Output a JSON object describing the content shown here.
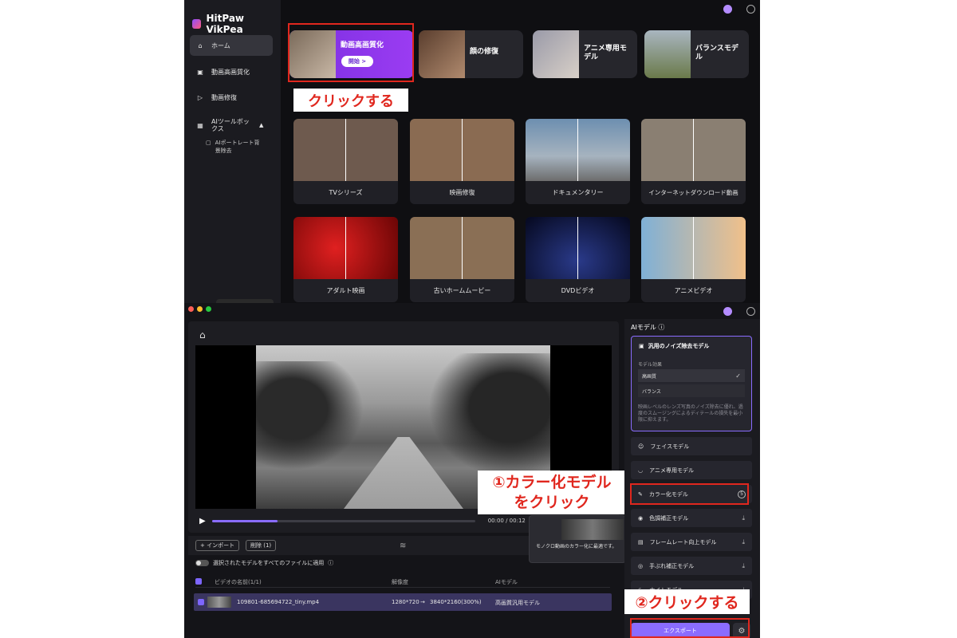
{
  "top_window": {
    "app_name": "HitPaw VikPea",
    "nav": [
      {
        "label": "ホーム"
      },
      {
        "label": "動画高画質化"
      },
      {
        "label": "動画修復"
      },
      {
        "label": "AIツールボックス"
      }
    ],
    "sub_item": "AIポートレート背景除去",
    "main_cards": [
      {
        "label": "動画高画質化",
        "button": "開始 >"
      },
      {
        "label": "顔の修復"
      },
      {
        "label": "アニメ専用モデル"
      },
      {
        "label": "バランスモデル"
      }
    ],
    "callout": "クリックする",
    "grid": [
      {
        "label": "TVシリーズ",
        "color": "#6e5a4e"
      },
      {
        "label": "映画修復",
        "color": "#8a6b52"
      },
      {
        "label": "ドキュメンタリー",
        "color": "#6d8fb0"
      },
      {
        "label": "インターネットダウンロード動画",
        "color": "#8a7f72"
      },
      {
        "label": "アダルト映画",
        "color": "#a50f0f"
      },
      {
        "label": "古いホームムービー",
        "color": "#8a6f55"
      },
      {
        "label": "DVDビデオ",
        "color": "#0e1b4e"
      },
      {
        "label": "アニメビデオ",
        "color": "#e8b07a"
      }
    ]
  },
  "bottom_window": {
    "time": "00:00 / 00:12",
    "tooltip": "モノクロ動画のカラー化に最適です。",
    "buttons": {
      "import": "+ インポート",
      "delete": "削除 (1)"
    },
    "apply_label": "選択されたモデルをすべてのファイルに適用",
    "table_headers": [
      "ビデオの名前(1/1)",
      "解像度",
      "AIモデル"
    ],
    "row": {
      "name": "109801-685694722_tiny.mp4",
      "res_from": "1280*720",
      "res_to": "3840*2160(300%)",
      "model": "高画質汎用モデル"
    },
    "panel_title": "AIモデル",
    "selected_model": {
      "title": "汎用のノイズ除去モデル",
      "effect_label": "モデル効果",
      "options": [
        "高画質",
        "バランス"
      ],
      "description": "映画レベルのレンズ写真のノイズ除去に優れ、過度のスムージングによるディテールの損失を最小限に抑えます。"
    },
    "models": [
      {
        "label": "フェイスモデル"
      },
      {
        "label": "アニメ専用モデル"
      },
      {
        "label": "カラー化モデル",
        "badge": "5"
      },
      {
        "label": "色調補正モデル"
      },
      {
        "label": "フレームレート向上モデル"
      },
      {
        "label": "手ぶれ補正モデル"
      },
      {
        "label": "ナイトモデル"
      }
    ],
    "export": "エクスポート",
    "callout_1": "①カラー化モデル",
    "callout_1b": "をクリック",
    "callout_2": "②クリックする"
  }
}
